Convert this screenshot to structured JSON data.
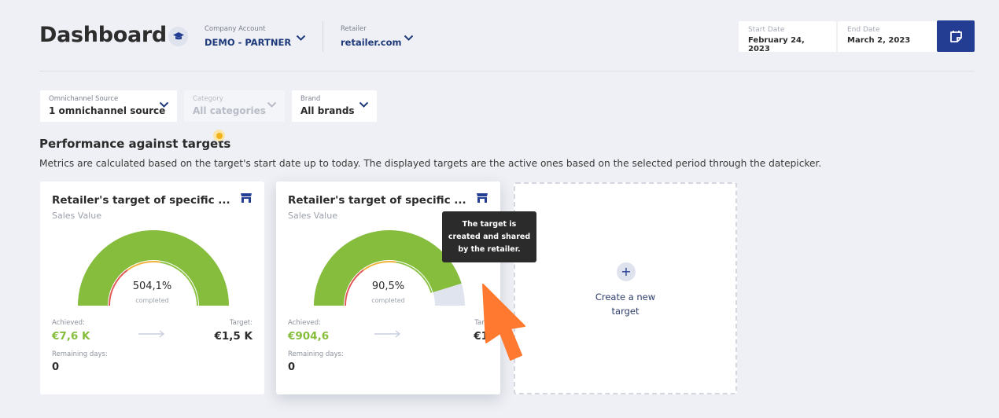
{
  "header": {
    "title": "Dashboard",
    "company": {
      "label": "Company Account",
      "value": "DEMO - PARTNER"
    },
    "retailer": {
      "label": "Retailer",
      "value": "retailer.com"
    },
    "start_date": {
      "label": "Start Date",
      "value": "February 24, 2023"
    },
    "end_date": {
      "label": "End Date",
      "value": "March 2, 2023"
    }
  },
  "filters": [
    {
      "label": "Omnichannel Source",
      "value": "1 omnichannel source",
      "disabled": false
    },
    {
      "label": "Category",
      "value": "All categories",
      "disabled": true
    },
    {
      "label": "Brand",
      "value": "All brands",
      "disabled": false
    }
  ],
  "section": {
    "title": "Performance against targets",
    "description": "Metrics are calculated based on the target's start date up to today. The displayed targets are the active ones based on the selected period through the datepicker."
  },
  "cards": [
    {
      "title": "Retailer's target of specific ...",
      "subtitle": "Sales Value",
      "percent": "504,1%",
      "percent_label": "completed",
      "progress": 1.0,
      "achieved_label": "Achieved:",
      "achieved": "€7,6 K",
      "target_label": "Target:",
      "target": "€1,5 K",
      "remaining_label": "Remaining days:",
      "remaining": "0"
    },
    {
      "title": "Retailer's target of specific ...",
      "subtitle": "Sales Value",
      "percent": "90,5%",
      "percent_label": "completed",
      "progress": 0.905,
      "achieved_label": "Achieved:",
      "achieved": "€904,6",
      "target_label": "Targ",
      "target": "€1",
      "remaining_label": "Remaining days:",
      "remaining": "0"
    }
  ],
  "create_card": {
    "line1": "Create a new",
    "line2": "target"
  },
  "tooltip": {
    "line1": "The target is",
    "line2": "created and shared",
    "line3": "by the retailer."
  },
  "colors": {
    "accent": "#233d93",
    "green": "#86bd3c",
    "track": "#dfe4ef",
    "tooltip_bg": "#2b2b2b",
    "cursor": "#ff7a30"
  }
}
